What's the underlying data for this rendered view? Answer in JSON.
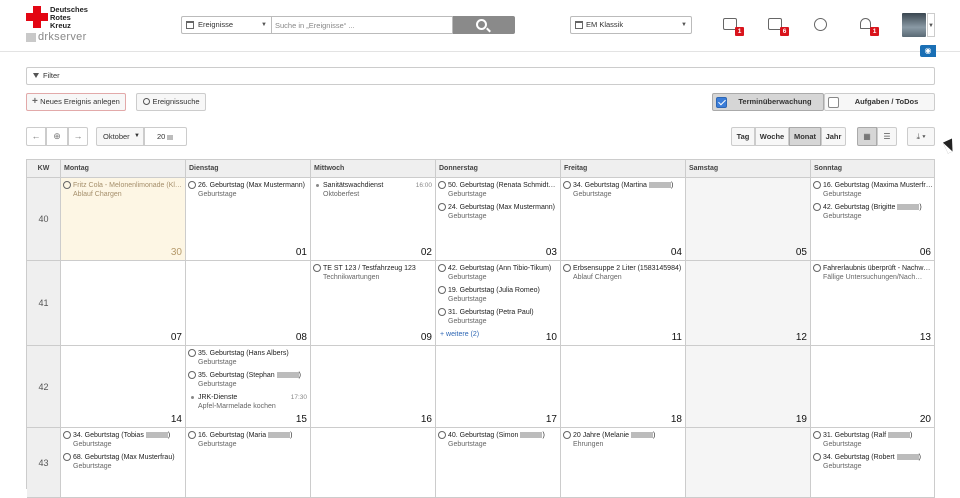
{
  "logo": {
    "line1": "Deutsches",
    "line2": "Rotes",
    "line3": "Kreuz",
    "sub": "drkserver"
  },
  "search": {
    "type_label": "Ereignisse",
    "placeholder": "Suche in „Ereignisse“ ..."
  },
  "view_select": "EM Klassik",
  "badges": {
    "messages": "1",
    "tasks": "6",
    "alarms": "1"
  },
  "toolbar": {
    "filter": "Filter",
    "new_event": "Neues Ereignis anlegen",
    "event_search": "Ereignissuche",
    "termin": "Terminüberwachung",
    "aufgaben": "Aufgaben / ToDos"
  },
  "nav": {
    "month": "Oktober",
    "year": "20"
  },
  "views": {
    "tag": "Tag",
    "woche": "Woche",
    "monat": "Monat",
    "jahr": "Jahr"
  },
  "headers": [
    "KW",
    "Montag",
    "Dienstag",
    "Mittwoch",
    "Donnerstag",
    "Freitag",
    "Samstag",
    "Sonntag"
  ],
  "weeks": [
    {
      "kw": "40",
      "days": [
        {
          "n": "30",
          "today": true,
          "ev": [
            {
              "i": "a",
              "t": "Fritz Cola - Melonenlimonade (Kl…",
              "s": "Ablauf Chargen"
            }
          ]
        },
        {
          "n": "01",
          "ev": [
            {
              "i": "a",
              "t": "26. Geburtstag (Max Mustermann)",
              "s": "Geburtstage"
            }
          ]
        },
        {
          "n": "02",
          "ev": [
            {
              "i": "d",
              "t": "Sanitätswachdienst",
              "tm": "16:00",
              "s": "Oktoberfest"
            }
          ]
        },
        {
          "n": "03",
          "ev": [
            {
              "i": "a",
              "t": "50. Geburtstag (Renata Schmidt…",
              "s": "Geburtstage"
            },
            {
              "i": "a",
              "t": "24. Geburtstag (Max Mustermann)",
              "s": "Geburtstage"
            }
          ]
        },
        {
          "n": "04",
          "ev": [
            {
              "i": "a",
              "t": "34. Geburtstag (Martina",
              "b": true,
              "s": "Geburtstage"
            }
          ]
        },
        {
          "n": "05",
          "we": true,
          "ev": []
        },
        {
          "n": "06",
          "ev": [
            {
              "i": "a",
              "t": "16. Geburtstag (Maxima Musterfr…",
              "s": "Geburtstage"
            },
            {
              "i": "a",
              "t": "42. Geburtstag (Brigitte",
              "b": true,
              "s": "Geburtstage"
            }
          ]
        }
      ]
    },
    {
      "kw": "41",
      "days": [
        {
          "n": "07",
          "ev": []
        },
        {
          "n": "08",
          "ev": []
        },
        {
          "n": "09",
          "ev": [
            {
              "i": "a",
              "t": "TE ST 123 / Testfahrzeug 123",
              "s": "Technikwartungen"
            }
          ]
        },
        {
          "n": "10",
          "ev": [
            {
              "i": "a",
              "t": "42. Geburtstag (Ann Tibio-Tikum)",
              "s": "Geburtstage"
            },
            {
              "i": "a",
              "t": "19. Geburtstag (Julia Romeo)",
              "s": "Geburtstage"
            },
            {
              "i": "a",
              "t": "31. Geburtstag (Petra Paul)",
              "s": "Geburtstage"
            }
          ],
          "more": "+ weitere (2)"
        },
        {
          "n": "11",
          "ev": [
            {
              "i": "a",
              "t": "Erbsensuppe 2 Liter (1583145984)",
              "s": "Ablauf Chargen"
            }
          ]
        },
        {
          "n": "12",
          "we": true,
          "ev": []
        },
        {
          "n": "13",
          "ev": [
            {
              "i": "a",
              "t": "Fahrerlaubnis überprüft - Nachw…",
              "s": "Fällige Untersuchungen/Nach…"
            }
          ]
        }
      ]
    },
    {
      "kw": "42",
      "days": [
        {
          "n": "14",
          "ev": []
        },
        {
          "n": "15",
          "ev": [
            {
              "i": "a",
              "t": "35. Geburtstag (Hans Albers)",
              "s": "Geburtstage"
            },
            {
              "i": "a",
              "t": "35. Geburtstag (Stephan",
              "b": true,
              "s": "Geburtstage"
            },
            {
              "i": "d",
              "t": "JRK-Dienste",
              "tm": "17:30",
              "s": "Apfel-Marmelade kochen"
            }
          ]
        },
        {
          "n": "16",
          "ev": []
        },
        {
          "n": "17",
          "ev": []
        },
        {
          "n": "18",
          "ev": []
        },
        {
          "n": "19",
          "we": true,
          "ev": []
        },
        {
          "n": "20",
          "ev": []
        }
      ]
    },
    {
      "kw": "43",
      "days": [
        {
          "n": "",
          "ev": [
            {
              "i": "a",
              "t": "34. Geburtstag (Tobias",
              "b": true,
              "s": "Geburtstage"
            },
            {
              "i": "a",
              "t": "68. Geburtstag (Max Musterfrau)",
              "s": "Geburtstage"
            }
          ]
        },
        {
          "n": "",
          "ev": [
            {
              "i": "a",
              "t": "16. Geburtstag (Maria",
              "b": true,
              "s": "Geburtstage"
            }
          ]
        },
        {
          "n": "",
          "ev": []
        },
        {
          "n": "",
          "ev": [
            {
              "i": "a",
              "t": "40. Geburtstag (Simon",
              "b": true,
              "s": "Geburtstage"
            }
          ]
        },
        {
          "n": "",
          "ev": [
            {
              "i": "a",
              "t": "20 Jahre (Melanie",
              "b": true,
              "s": "Ehrungen"
            }
          ]
        },
        {
          "n": "",
          "we": true,
          "ev": []
        },
        {
          "n": "",
          "ev": [
            {
              "i": "a",
              "t": "31. Geburtstag (Ralf",
              "b": true,
              "s": "Geburtstage"
            },
            {
              "i": "a",
              "t": "34. Geburtstag (Robert",
              "b": true,
              "s": "Geburtstage"
            }
          ]
        }
      ]
    }
  ]
}
